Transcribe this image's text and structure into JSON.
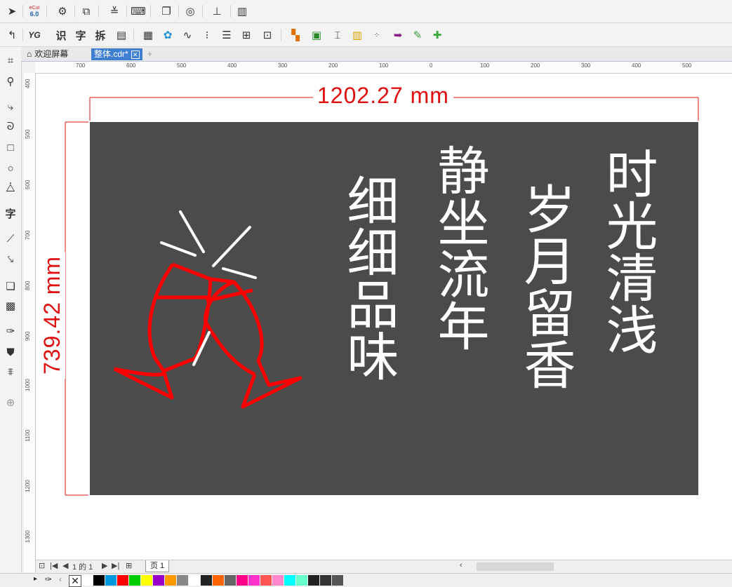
{
  "toolbar_top": {
    "ecut_label": "eCut",
    "ecut_version": "6.0"
  },
  "toolbar_second": {
    "yg_label": "YG",
    "recognize_label": "识",
    "text_label": "字",
    "split_label": "拆"
  },
  "tabs": [
    {
      "label": "欢迎屏幕"
    },
    {
      "label": "整体.cdr*"
    }
  ],
  "toolbox": {
    "text_tool_label": "字"
  },
  "ruler_h_ticks": [
    "700",
    "600",
    "500",
    "400",
    "300",
    "200",
    "100",
    "0",
    "100",
    "200",
    "300",
    "400",
    "500"
  ],
  "ruler_v_ticks": [
    "400",
    "500",
    "600",
    "700",
    "800",
    "900",
    "1000",
    "1100",
    "1200",
    "1300"
  ],
  "dimensions": {
    "width": "1202.27 mm",
    "height": "739.42 mm"
  },
  "poem": {
    "col1": "时光清浅",
    "col2": "岁月留香",
    "col3": "静坐流年",
    "col4": "细细品味"
  },
  "colors": {
    "panel": "#4b4b4b",
    "dimension": "#e01010",
    "glass": "#ff0000",
    "text": "#ffffff"
  },
  "pagebar": {
    "page_count": "1 的 1",
    "page_tab": "页 1"
  },
  "palette": [
    "#ffffff",
    "#000000",
    "#0099e0",
    "#ff0000",
    "#00cc00",
    "#ffff00",
    "#9900cc",
    "#ff9900",
    "#888888",
    "#ffffff",
    "#222222",
    "#ff6600",
    "#666666",
    "#ff0088",
    "#ff33cc",
    "#ff5555",
    "#ff88cc",
    "#00ffff",
    "#66ffcc",
    "#222222",
    "#333333",
    "#555555"
  ]
}
